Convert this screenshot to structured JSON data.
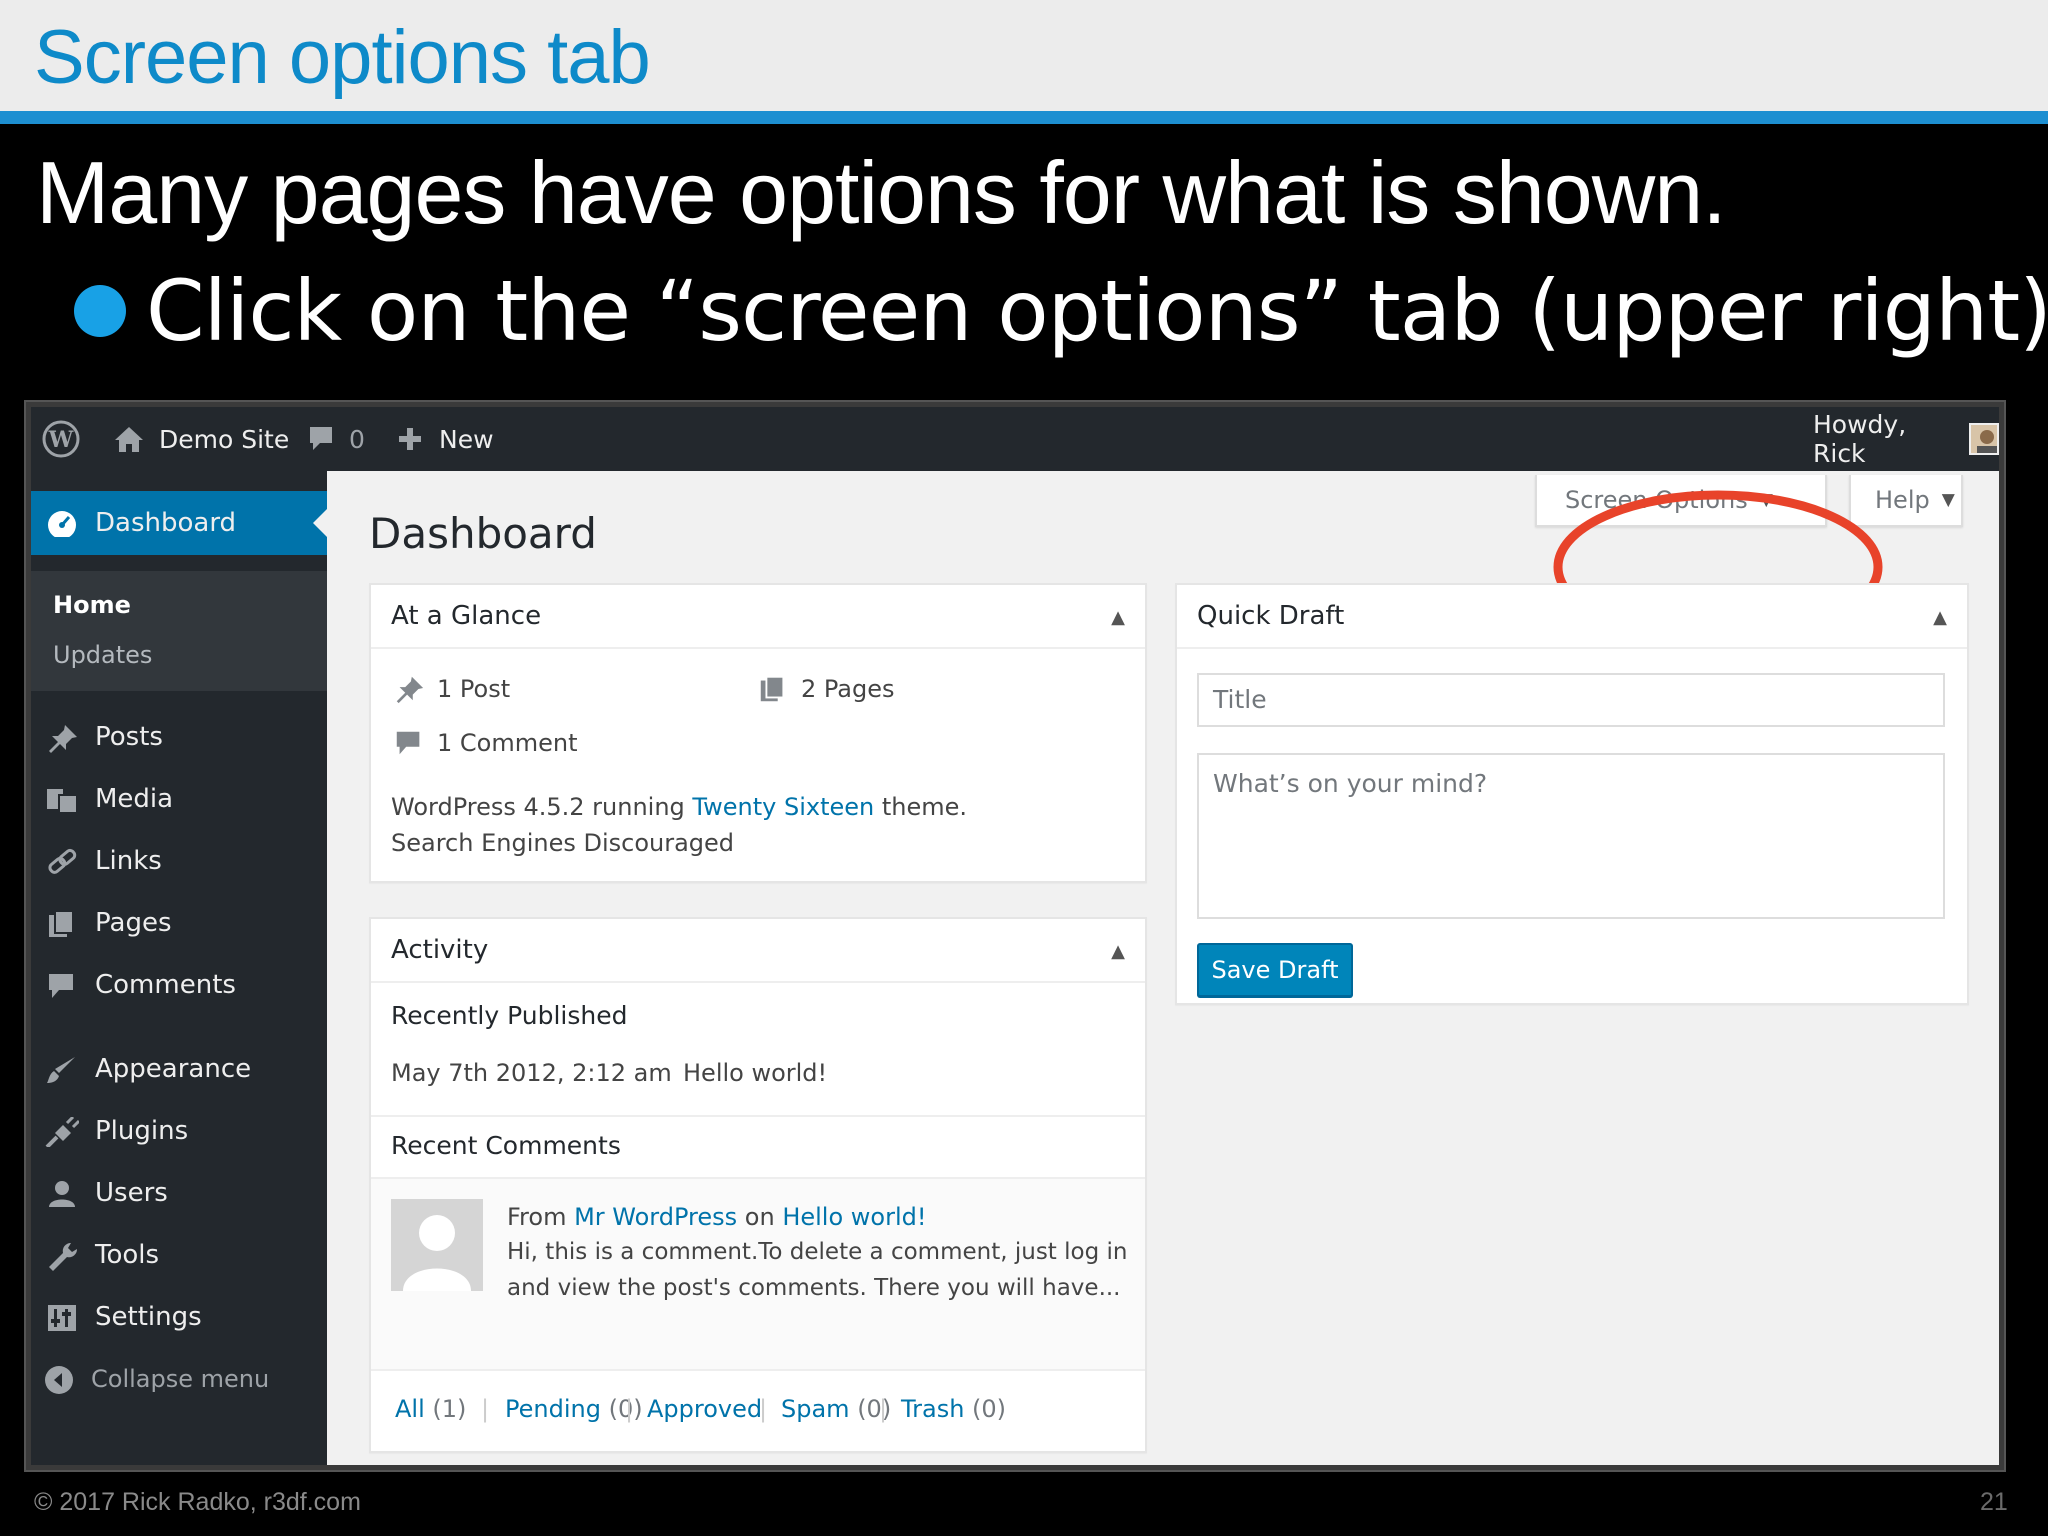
{
  "slide": {
    "title": "Screen options tab",
    "heading": "Many pages have options for what is shown.",
    "bullet": "Click on the “screen options” tab (upper right).",
    "footer_left": "© 2017 Rick Radko, r3df.com",
    "page_number": "21"
  },
  "adminbar": {
    "site_name": "Demo Site",
    "comment_count": "0",
    "new_label": "New",
    "howdy": "Howdy, Rick"
  },
  "sidebar": {
    "dashboard": "Dashboard",
    "submenu": [
      "Home",
      "Updates"
    ],
    "items": [
      "Posts",
      "Media",
      "Links",
      "Pages",
      "Comments",
      "Appearance",
      "Plugins",
      "Users",
      "Tools",
      "Settings"
    ],
    "collapse": "Collapse menu"
  },
  "main": {
    "page_title": "Dashboard",
    "screen_options": "Screen Options",
    "help": "Help",
    "caret": "▼",
    "toggle": "▲"
  },
  "at_a_glance": {
    "title": "At a Glance",
    "posts": "1 Post",
    "pages": "2 Pages",
    "comments": "1 Comment",
    "version_prefix": "WordPress 4.5.2 running ",
    "theme_link": "Twenty Sixteen",
    "version_suffix": " theme.",
    "search_engines": "Search Engines Discouraged"
  },
  "activity": {
    "title": "Activity",
    "recently_published": "Recently Published",
    "post_date": "May 7th 2012, 2:12 am",
    "post_link": "Hello world!",
    "recent_comments": "Recent Comments",
    "comment_from": "From ",
    "comment_author": "Mr WordPress",
    "comment_on": " on ",
    "comment_post": "Hello world!",
    "comment_line1": "Hi, this is a comment.To delete a comment, just log in",
    "comment_line2": "and view the post's comments. There you will have...",
    "filters": [
      {
        "label": "All",
        "count": " (1)"
      },
      {
        "label": "Pending",
        "count": " (0)"
      },
      {
        "label": "Approved",
        "count": ""
      },
      {
        "label": "Spam",
        "count": " (0)"
      },
      {
        "label": "Trash",
        "count": " (0)"
      }
    ],
    "separator": "|"
  },
  "quick_draft": {
    "title": "Quick Draft",
    "title_placeholder": "Title",
    "content_placeholder": "What’s on your mind?",
    "save_label": "Save Draft"
  },
  "colors": {
    "accent_blue": "#0073aa",
    "slide_title_blue": "#0e8ac9",
    "highlight_circle": "#e8432a"
  }
}
